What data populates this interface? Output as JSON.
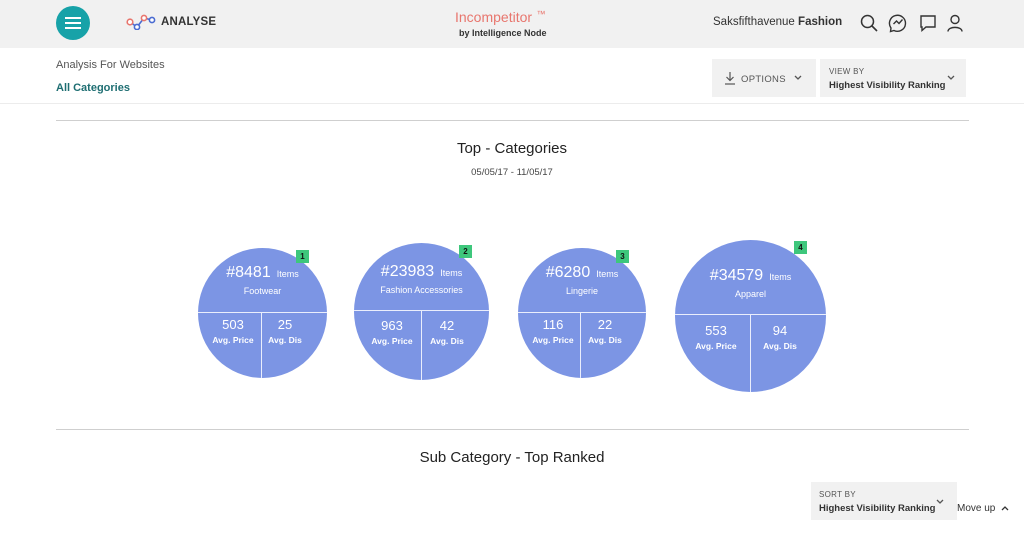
{
  "header": {
    "section": "ANALYSE",
    "brand": "Incompetitor",
    "brand_mark": "™",
    "brand_sub": "by Intelligence Node",
    "store_name": "Saksfifthavenue",
    "store_segment": "Fashion"
  },
  "subheader": {
    "title": "Analysis For Websites",
    "category": "All Categories",
    "options_label": "OPTIONS",
    "view_by_label": "VIEW BY",
    "view_by_value": "Highest Visibility Ranking"
  },
  "top_categories": {
    "title": "Top - Categories",
    "date_range": "05/05/17 - 11/05/17",
    "items": [
      {
        "rank": "1",
        "count": "#8481",
        "items_label": "Items",
        "name": "Footwear",
        "price": "503",
        "price_label": "Avg. Price",
        "dis": "25",
        "dis_label": "Avg. Dis"
      },
      {
        "rank": "2",
        "count": "#23983",
        "items_label": "Items",
        "name": "Fashion Accessories",
        "price": "963",
        "price_label": "Avg. Price",
        "dis": "42",
        "dis_label": "Avg. Dis"
      },
      {
        "rank": "3",
        "count": "#6280",
        "items_label": "Items",
        "name": "Lingerie",
        "price": "116",
        "price_label": "Avg. Price",
        "dis": "22",
        "dis_label": "Avg. Dis"
      },
      {
        "rank": "4",
        "count": "#34579",
        "items_label": "Items",
        "name": "Apparel",
        "price": "553",
        "price_label": "Avg. Price",
        "dis": "94",
        "dis_label": "Avg. Dis"
      }
    ]
  },
  "sub_category": {
    "title": "Sub Category - Top Ranked",
    "sort_by_label": "SORT BY",
    "sort_by_value": "Highest Visibility Ranking",
    "move_up": "Move up"
  },
  "colors": {
    "accent": "#17a2a8",
    "bubble": "#7c95e4",
    "rank_badge": "#3ec77c",
    "brand": "#e8766e"
  },
  "icons": [
    "menu-icon",
    "analyse-icon",
    "search-icon",
    "analytics-icon",
    "comment-icon",
    "user-icon",
    "download-icon",
    "chevron-down-icon",
    "chevron-up-icon"
  ]
}
